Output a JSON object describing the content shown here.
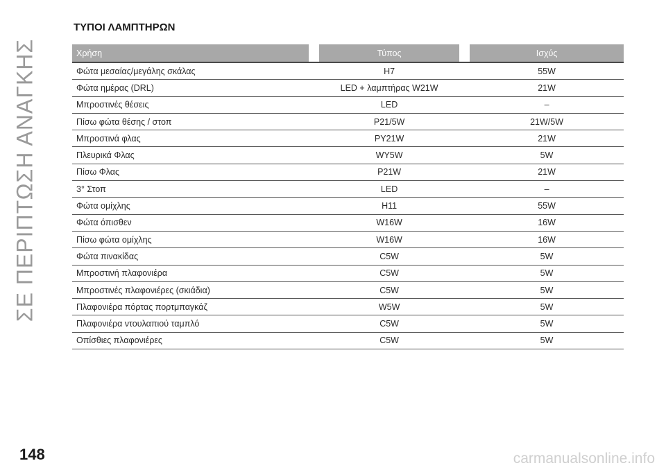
{
  "side_title": "ΣΕ ΠΕΡΙΠΤΩΣΗ ΑΝΑΓΚΗΣ",
  "heading": "ΤΥΠΟΙ ΛΑΜΠΤΗΡΩΝ",
  "table": {
    "headers": {
      "use": "Χρήση",
      "type": "Τύπος",
      "power": "Ισχύς"
    },
    "rows": [
      {
        "use": "Φώτα μεσαίας/μεγάλης σκάλας",
        "type": "H7",
        "power": "55W"
      },
      {
        "use": "Φώτα ημέρας (DRL)",
        "type": "LED + λαμπτήρας W21W",
        "power": "21W"
      },
      {
        "use": "Μπροστινές θέσεις",
        "type": "LED",
        "power": "–"
      },
      {
        "use": "Πίσω φώτα θέσης / στοπ",
        "type": "P21/5W",
        "power": "21W/5W"
      },
      {
        "use": "Μπροστινά φλας",
        "type": "PY21W",
        "power": "21W"
      },
      {
        "use": "Πλευρικά Φλας",
        "type": "WY5W",
        "power": "5W"
      },
      {
        "use": "Πίσω Φλας",
        "type": "P21W",
        "power": "21W"
      },
      {
        "use": "3° Στοπ",
        "type": "LED",
        "power": "–"
      },
      {
        "use": "Φώτα ομίχλης",
        "type": "H11",
        "power": "55W"
      },
      {
        "use": "Φώτα όπισθεν",
        "type": "W16W",
        "power": "16W"
      },
      {
        "use": "Πίσω φώτα ομίχλης",
        "type": "W16W",
        "power": "16W"
      },
      {
        "use": "Φώτα πινακίδας",
        "type": "C5W",
        "power": "5W"
      },
      {
        "use": "Μπροστινή πλαφονιέρα",
        "type": "C5W",
        "power": "5W"
      },
      {
        "use": "Μπροστινές πλαφονιέρες (σκιάδια)",
        "type": "C5W",
        "power": "5W"
      },
      {
        "use": "Πλαφονιέρα πόρτας πορτμπαγκάζ",
        "type": "W5W",
        "power": "5W"
      },
      {
        "use": "Πλαφονιέρα ντουλαπιού ταμπλό",
        "type": "C5W",
        "power": "5W"
      },
      {
        "use": "Οπίσθιες πλαφονιέρες",
        "type": "C5W",
        "power": "5W"
      }
    ]
  },
  "page_number": "148",
  "watermark": "carmanualsonline.info"
}
